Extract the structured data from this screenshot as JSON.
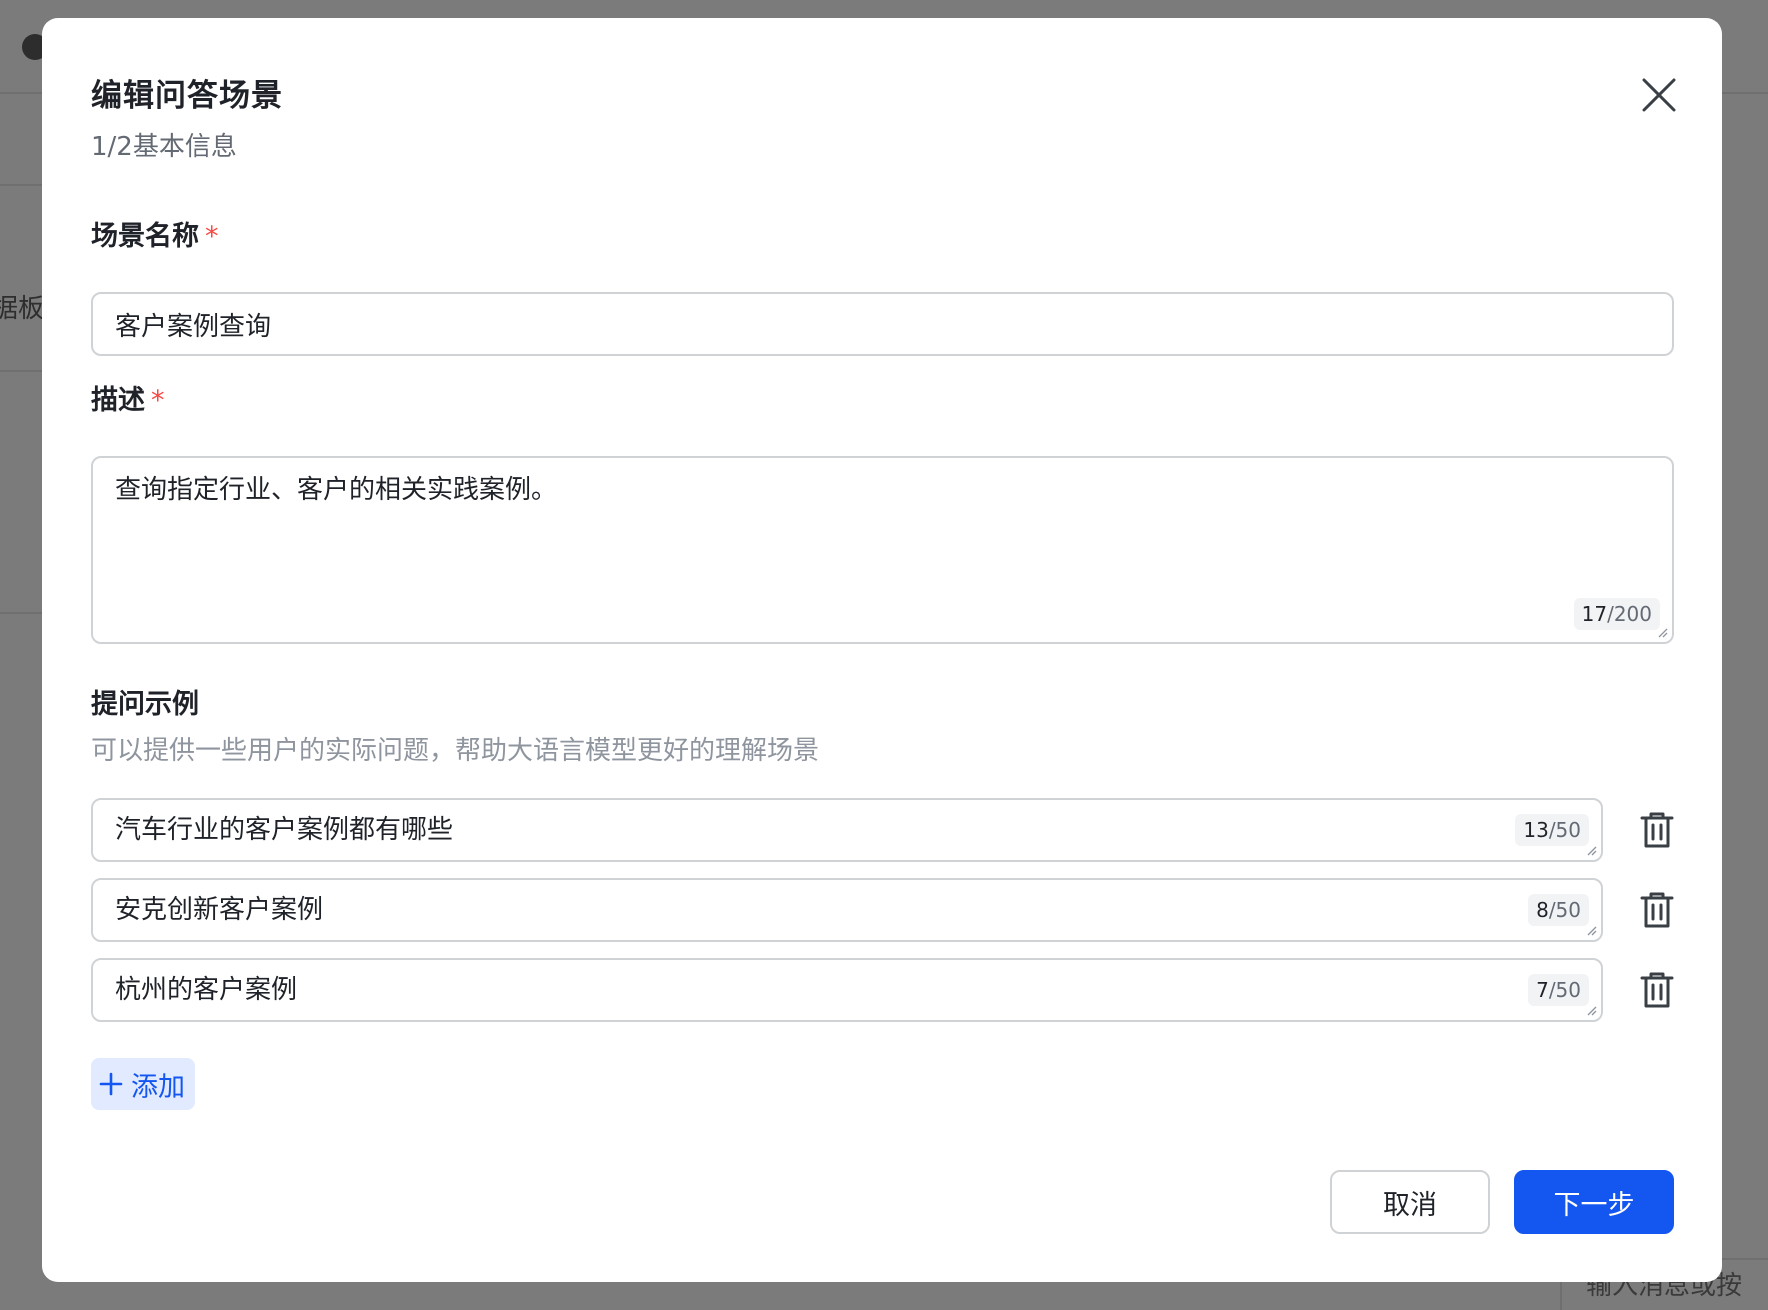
{
  "background": {
    "sidebar_fragment": "据板",
    "input_placeholder": "输入消息或按"
  },
  "modal": {
    "title": "编辑问答场景",
    "subtitle": "1/2基本信息",
    "close_icon": "close-icon"
  },
  "scene_name": {
    "label": "场景名称",
    "required_mark": "*",
    "value": "客户案例查询"
  },
  "description": {
    "label": "描述",
    "required_mark": "*",
    "value": "查询指定行业、客户的相关实践案例。",
    "count": "17",
    "max": "/200"
  },
  "examples": {
    "label": "提问示例",
    "hint": "可以提供一些用户的实际问题，帮助大语言模型更好的理解场景",
    "items": [
      {
        "text": "汽车行业的客户案例都有哪些",
        "count": "13",
        "max": "/50"
      },
      {
        "text": "安克创新客户案例",
        "count": "8",
        "max": "/50"
      },
      {
        "text": "杭州的客户案例",
        "count": "7",
        "max": "/50"
      }
    ],
    "delete_icon": "trash-icon",
    "add_label": "添加",
    "add_icon": "plus-icon"
  },
  "footer": {
    "cancel_label": "取消",
    "next_label": "下一步"
  },
  "colors": {
    "primary": "#1456f0",
    "required": "#f54a45",
    "add_bg": "#e1eaff",
    "overlay": "#7b7b7b"
  }
}
